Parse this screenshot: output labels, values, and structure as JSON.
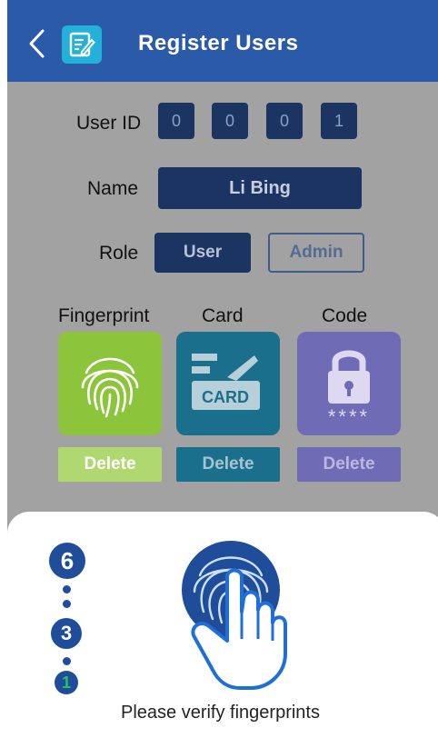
{
  "header": {
    "title": "Register Users"
  },
  "form": {
    "user_id_label": "User ID",
    "user_id_digits": [
      "0",
      "0",
      "0",
      "1"
    ],
    "name_label": "Name",
    "name_value": "Li Bing",
    "role_label": "Role",
    "role_options": [
      "User",
      "Admin"
    ],
    "role_selected": "User"
  },
  "methods": [
    {
      "label": "Fingerprint",
      "delete_label": "Delete",
      "icon": "fingerprint-icon",
      "color": "#8cc43c",
      "delete_color": "#b0d870"
    },
    {
      "label": "Card",
      "delete_label": "Delete",
      "icon": "card-icon",
      "card_text": "CARD",
      "color": "#1a6f8d",
      "delete_color": "#1a6f8d"
    },
    {
      "label": "Code",
      "delete_label": "Delete",
      "icon": "lock-icon",
      "code_mask": "****",
      "color": "#6f6bb5",
      "delete_color": "#6f6bb5"
    }
  ],
  "enrollment": {
    "steps": [
      "6",
      "3",
      "1"
    ],
    "prompt": "Please verify fingerprints"
  },
  "colors": {
    "header": "#2a5aa8",
    "app_icon": "#24b1d9",
    "overlay_bg": "#a2a2a2",
    "step_active": "#22c55e"
  }
}
